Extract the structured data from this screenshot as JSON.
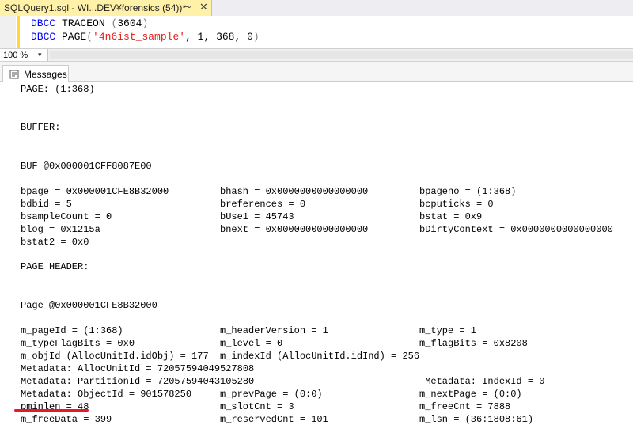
{
  "tab": {
    "title": "SQLQuery1.sql - WI...DEV¥forensics (54))*",
    "pin_glyph": "⊸",
    "close_glyph": "✕"
  },
  "editor": {
    "line1": {
      "keyword": "DBCC",
      "rest": " TRACEON ",
      "open": "(",
      "arg": "3604",
      "close": ")"
    },
    "line2": {
      "keyword": "DBCC",
      "rest": " PAGE",
      "open": "(",
      "str": "'4n6ist_sample'",
      "args": ", 1, 368, 0",
      "close": ")"
    }
  },
  "zoom": {
    "value": "100 %",
    "arrow": "▾"
  },
  "results": {
    "tab_label": "Messages"
  },
  "output": {
    "page": "PAGE: (1:368)",
    "buffer": "BUFFER:",
    "buf": "BUF @0x000001CFF8087E00",
    "buf_rows": [
      [
        "bpage = 0x000001CFE8B32000",
        "bhash = 0x0000000000000000",
        "bpageno = (1:368)"
      ],
      [
        "bdbid = 5",
        "breferences = 0",
        "bcputicks = 0"
      ],
      [
        "bsampleCount = 0",
        "bUse1 = 45743",
        "bstat = 0x9"
      ],
      [
        "blog = 0x1215a",
        "bnext = 0x0000000000000000",
        "bDirtyContext = 0x0000000000000000"
      ],
      [
        "bstat2 = 0x0",
        "",
        ""
      ]
    ],
    "page_header": "PAGE HEADER:",
    "page_addr": "Page @0x000001CFE8B32000",
    "hdr_rows": [
      [
        "m_pageId = (1:368)",
        "m_headerVersion = 1",
        "m_type = 1"
      ],
      [
        "m_typeFlagBits = 0x0",
        "m_level = 0",
        "m_flagBits = 0x8208"
      ],
      [
        "m_objId (AllocUnitId.idObj) = 177",
        "m_indexId (AllocUnitId.idInd) = 256",
        ""
      ],
      [
        "Metadata: AllocUnitId = 72057594049527808",
        "",
        ""
      ],
      [
        "Metadata: PartitionId = 72057594043105280",
        "",
        " Metadata: IndexId = 0"
      ],
      [
        "Metadata: ObjectId = 901578250",
        "m_prevPage = (0:0)",
        "m_nextPage = (0:0)"
      ],
      [
        "pminlen = 48",
        "m_slotCnt = 3",
        "m_freeCnt = 7888"
      ],
      [
        "m_freeData = 399",
        "m_reservedCnt = 101",
        "m_lsn = (36:1808:61)"
      ]
    ]
  },
  "colors": {
    "highlight": "#e8182a",
    "tab_bg": "#fff1a8",
    "keyword": "#0000ff",
    "string": "#e0201a"
  }
}
